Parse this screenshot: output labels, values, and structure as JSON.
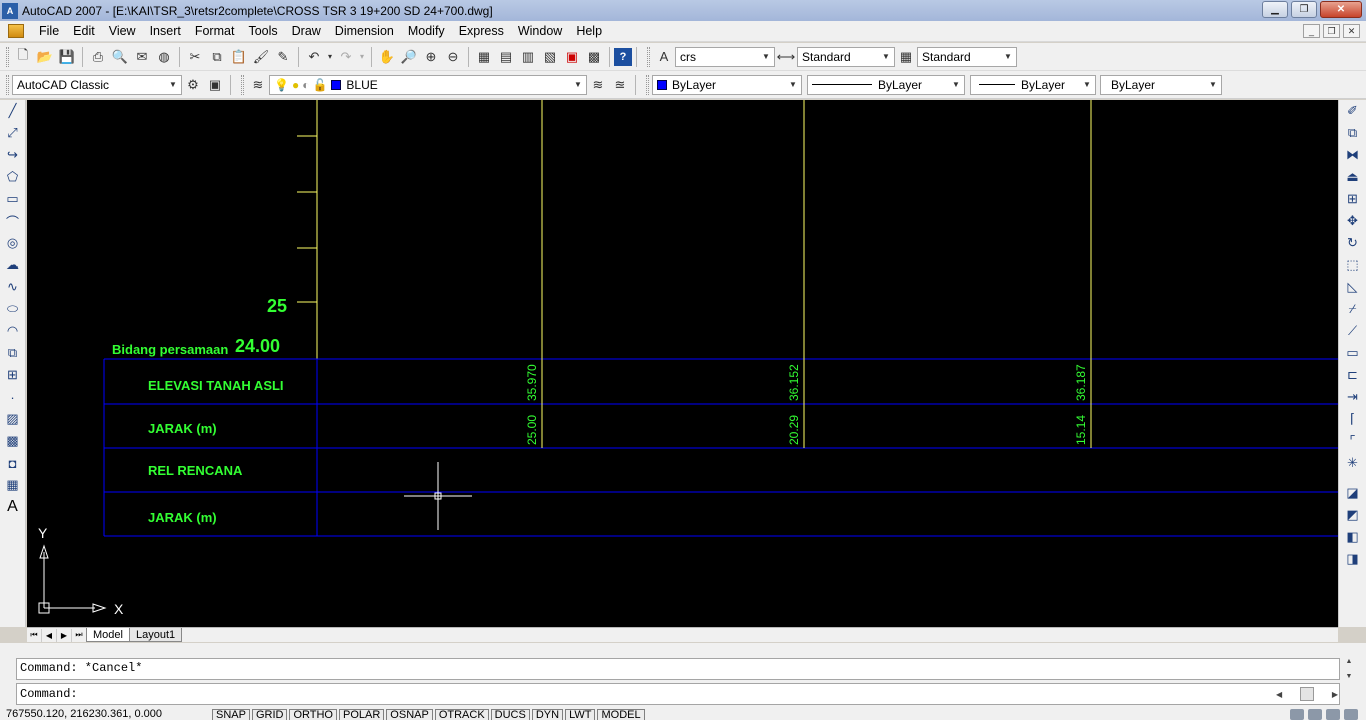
{
  "window": {
    "title": "AutoCAD 2007 - [E:\\KAI\\TSR_3\\retsr2complete\\CROSS TSR 3 19+200 SD 24+700.dwg]",
    "buttons": [
      "minimize",
      "maximize",
      "close"
    ]
  },
  "menu": [
    "File",
    "Edit",
    "View",
    "Insert",
    "Format",
    "Tools",
    "Draw",
    "Dimension",
    "Modify",
    "Express",
    "Window",
    "Help"
  ],
  "toolbar1": {
    "text_style": "crs",
    "dim_style": "Standard",
    "table_style": "Standard"
  },
  "toolbar2": {
    "workspace": "AutoCAD Classic",
    "layer": "BLUE",
    "color": "ByLayer",
    "linetype": "ByLayer",
    "lineweight": "ByLayer",
    "plotstyle": "ByLayer",
    "colors": {
      "layer_swatch": "#0000ff"
    }
  },
  "drawing": {
    "scale_label": "25",
    "datum_label": "Bidang persamaan",
    "datum_value": "24.00",
    "rows": [
      "ELEVASI TANAH ASLI",
      "JARAK (m)",
      "REL RENCANA",
      "JARAK (m)"
    ],
    "stations": [
      {
        "distance": "25.00",
        "elevation": "35.970"
      },
      {
        "distance": "20.29",
        "elevation": "36.152"
      },
      {
        "distance": "15.14",
        "elevation": "36.187"
      }
    ],
    "ucs": {
      "x": "X",
      "y": "Y"
    },
    "colors": {
      "text": "#33ff33",
      "grid": "#0000ff",
      "axis": "#ffff66",
      "background": "#000000"
    }
  },
  "tabs": {
    "model": "Model",
    "layout1": "Layout1"
  },
  "command": {
    "history": "Command: *Cancel*",
    "prompt": "Command:"
  },
  "status": {
    "coords": "767550.120, 216230.361, 0.000",
    "toggles": [
      "SNAP",
      "GRID",
      "ORTHO",
      "POLAR",
      "OSNAP",
      "OTRACK",
      "DUCS",
      "DYN",
      "LWT",
      "MODEL"
    ]
  }
}
